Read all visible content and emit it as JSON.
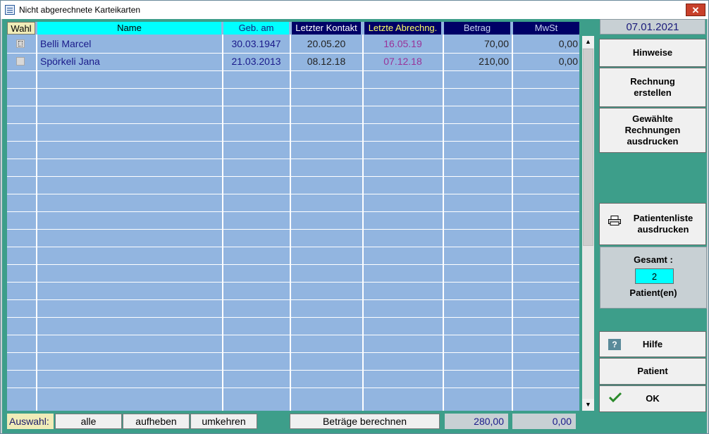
{
  "window": {
    "title": "Nicht abgerechnete Karteikarten",
    "close_label": "✕"
  },
  "colors": {
    "header_cyan": "#00ffff",
    "header_navy": "#000066",
    "grid_bg": "#92b5e0",
    "purple_text": "#993399"
  },
  "table": {
    "headers": [
      "Wahl",
      "Name",
      "Geb. am",
      "Letzter Kontakt",
      "Letzte Abrechng.",
      "Betrag",
      "MwSt"
    ],
    "rows": [
      {
        "name": "Belli Marcel",
        "geb": "30.03.1947",
        "kontakt": "20.05.20",
        "abrechnung": "16.05.19",
        "betrag": "70,00",
        "mwst": "0,00"
      },
      {
        "name": "Spörkeli Jana",
        "geb": "21.03.2013",
        "kontakt": "08.12.18",
        "abrechnung": "07.12.18",
        "betrag": "210,00",
        "mwst": "0,00"
      }
    ]
  },
  "bottom": {
    "auswahl_label": "Auswahl:",
    "alle": "alle",
    "aufheben": "aufheben",
    "umkehren": "umkehren",
    "berechnen": "Beträge berechnen",
    "sum_betrag": "280,00",
    "sum_mwst": "0,00"
  },
  "side": {
    "date": "07.01.2021",
    "hinweise": "Hinweise",
    "rechnung": [
      "Rechnung",
      "erstellen"
    ],
    "drucken": [
      "Gewählte",
      "Rechnungen",
      "ausdrucken"
    ],
    "patientenliste": [
      "Patientenliste",
      "ausdrucken"
    ],
    "gesamt_label": "Gesamt :",
    "gesamt_count": "2",
    "gesamt_unit": "Patient(en)",
    "hilfe": "Hilfe",
    "patient": "Patient",
    "ok": "OK"
  }
}
